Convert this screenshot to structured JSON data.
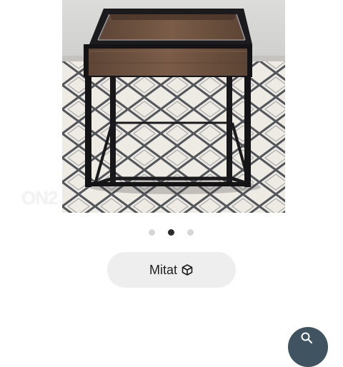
{
  "gallery": {
    "watermark": "ON2",
    "total_images": 3,
    "active_index": 1
  },
  "size_button": {
    "label": "Mitat",
    "icon": "cube-icon"
  },
  "search_fab": {
    "icon": "search-icon"
  },
  "colors": {
    "dot_active": "#2b2b2b",
    "dot_inactive": "#d6d6d6",
    "button_bg": "#eeeeee",
    "fab_bg": "#3f5360"
  }
}
